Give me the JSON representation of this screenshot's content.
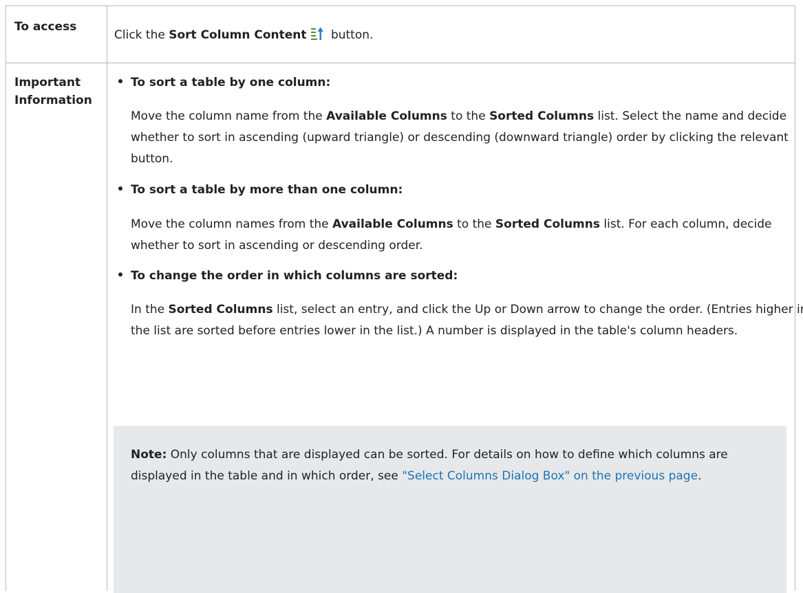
{
  "rows": {
    "access": {
      "label": "To access",
      "text_before": "Click the ",
      "bold": "Sort Column Content",
      "icon": "sort-ascending-icon",
      "text_after": " button."
    },
    "info": {
      "label_line1": "Important",
      "label_line2": "Information",
      "sections": [
        {
          "heading": "To sort a table by one column:",
          "p1": "Move the column name from the ",
          "b1": "Available Columns",
          "p2": " to the ",
          "b2": "Sorted Columns",
          "p3": " list. Select the name and decide whether to sort in ascending (upward triangle) or descending (downward triangle) order by clicking the relevant button."
        },
        {
          "heading": "To sort a table by more than one column:",
          "p1": "Move the column names from the ",
          "b1": "Available Columns",
          "p2": " to the ",
          "b2": "Sorted Columns",
          "p3": " list. For each column, decide whether to sort in ascending or descending order."
        },
        {
          "heading": "To change the order in which columns are sorted:",
          "p1": "In the ",
          "b1": "Sorted Columns",
          "p2": " list, select an entry, and click the Up or Down arrow to change the order. (Entries higher in the list are sorted before entries lower in the list.) A number is displayed in the table's column headers."
        }
      ],
      "note": {
        "label": "Note:",
        "text": " Only columns that are displayed can be sorted. For details on how to define which columns are displayed in the table and in which order, see ",
        "link": "\"Select Columns Dialog Box\" on the previous page",
        "end": "."
      }
    }
  },
  "colors": {
    "link": "#1a73b8",
    "note_background": "#e7e8e9",
    "border": "#b7b7b7"
  }
}
